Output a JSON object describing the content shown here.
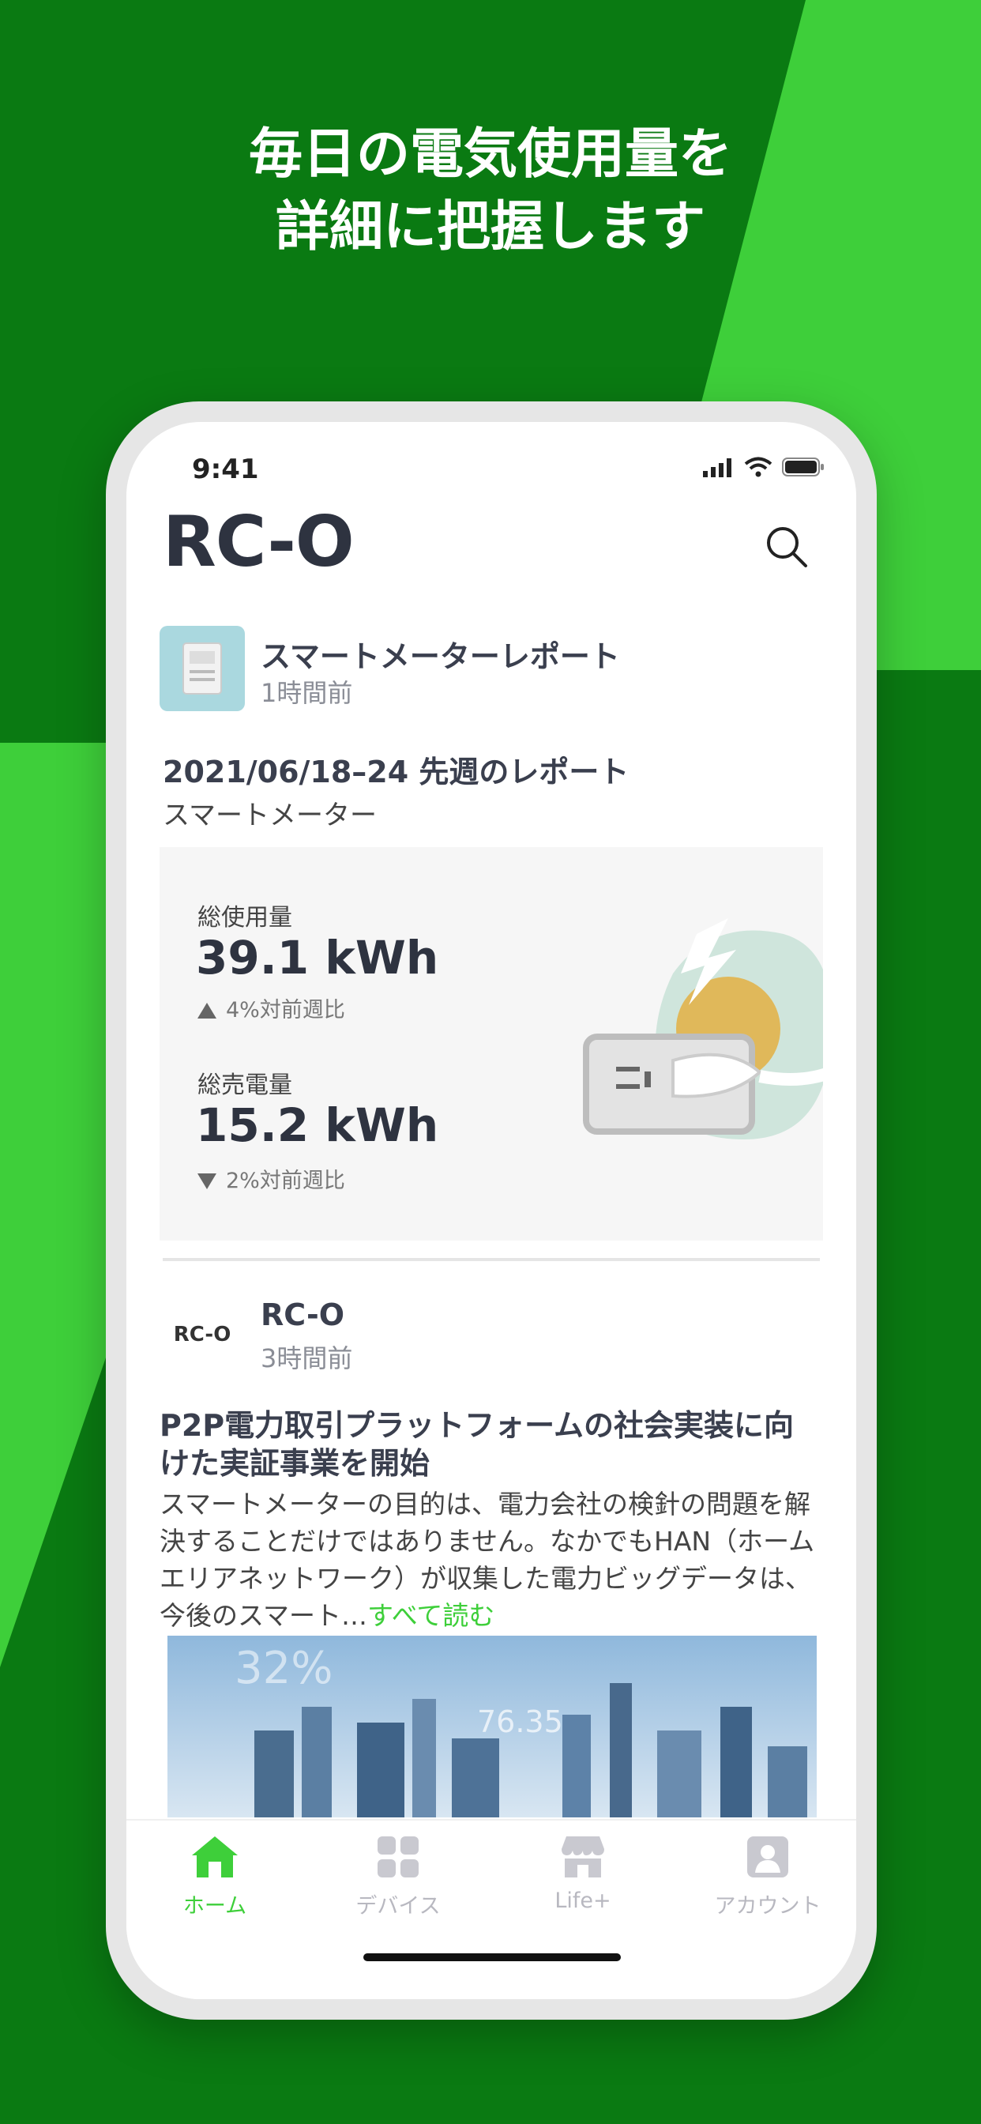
{
  "promo": {
    "headline_line1": "毎日の電気使用量を",
    "headline_line2": "詳細に把握します"
  },
  "colors": {
    "brand_green": "#3ecf3a",
    "dark_green": "#0a7a12"
  },
  "status_bar": {
    "time": "9:41"
  },
  "app": {
    "title": "RC-O"
  },
  "card_report": {
    "source": "スマートメーターレポート",
    "posted": "1時間前",
    "title": "2021/06/18–24 先週のレポート",
    "subtitle": "スマートメーター",
    "usage_label": "総使用量",
    "usage_value": "39.1 kWh",
    "usage_delta": "4%対前週比",
    "sold_label": "総売電量",
    "sold_value": "15.2 kWh",
    "sold_delta": "2%対前週比"
  },
  "card_article": {
    "logo_text": "RC-O",
    "source": "RC-O",
    "posted": "3時間前",
    "title": "P2P電力取引プラットフォームの社会実装に向けた実証事業を開始",
    "body": "スマートメーターの目的は、電力会社の検針の問題を解決することだけではありません。なかでもHAN（ホームエリアネットワーク）が収集した電力ビッグデータは、今後のスマート…",
    "read_more": "すべて読む",
    "image_text_percent": "32%",
    "image_text_value": "76.35"
  },
  "tabs": [
    {
      "label": "ホーム",
      "icon": "home-icon",
      "active": true
    },
    {
      "label": "デバイス",
      "icon": "grid-icon",
      "active": false
    },
    {
      "label": "Life+",
      "icon": "store-icon",
      "active": false
    },
    {
      "label": "アカウント",
      "icon": "account-icon",
      "active": false
    }
  ]
}
